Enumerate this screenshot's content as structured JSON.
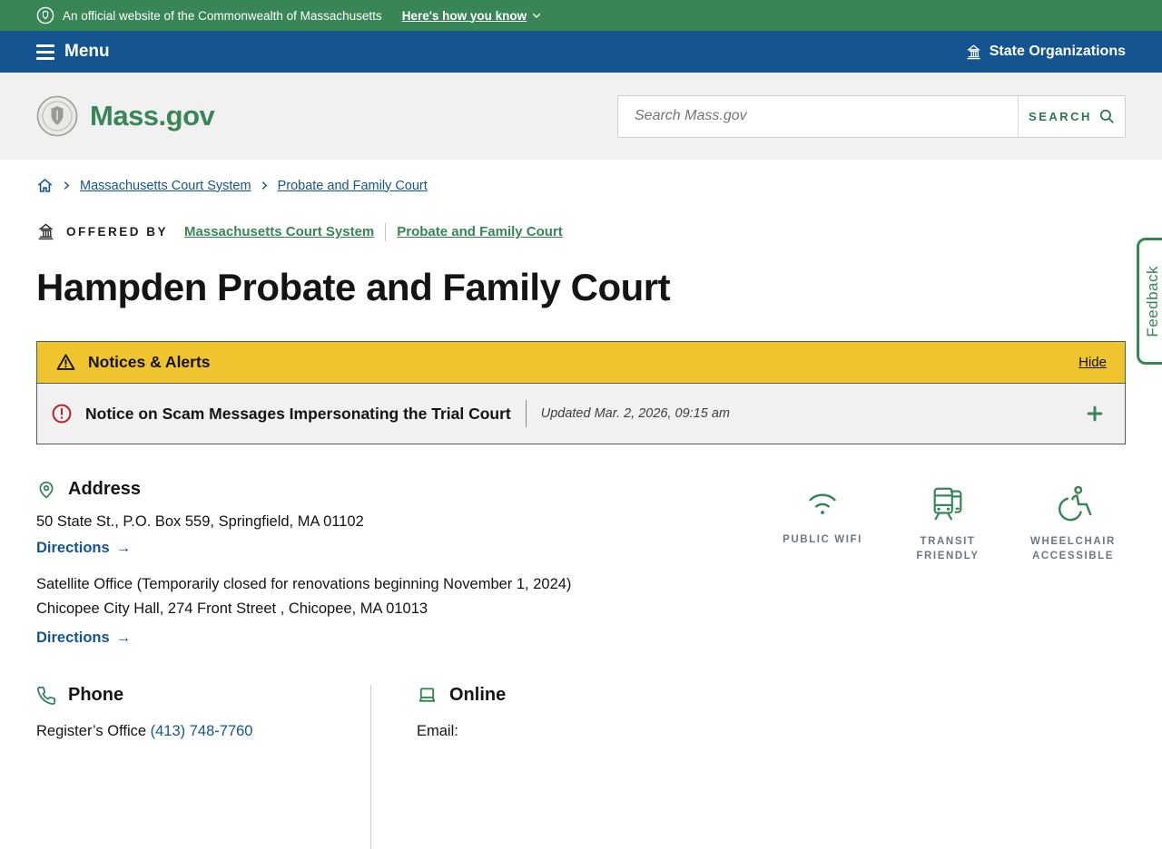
{
  "colors": {
    "green": "#388557",
    "blue": "#14558f",
    "yellow": "#f0c42e",
    "red": "#b7232e",
    "muted_label": "#6f7780",
    "text": "#141414"
  },
  "banner": {
    "text": "An official website of the Commonwealth of Massachusetts",
    "link": "Here's how you know"
  },
  "nav": {
    "menu": "Menu",
    "state_organizations": "State Organizations"
  },
  "header": {
    "logo": "Mass.gov",
    "search_placeholder": "Search Mass.gov",
    "search_button": "SEARCH"
  },
  "breadcrumb": {
    "items": [
      {
        "label": "Massachusetts Court System"
      },
      {
        "label": "Probate and Family Court"
      }
    ]
  },
  "offered_by": {
    "label": "OFFERED BY",
    "links": [
      {
        "label": "Massachusetts Court System"
      },
      {
        "label": "Probate and Family Court"
      }
    ]
  },
  "page": {
    "title": "Hampden Probate and Family Court"
  },
  "notices": {
    "heading": "Notices & Alerts",
    "hide": "Hide",
    "items": [
      {
        "title": "Notice on Scam Messages Impersonating the Trial Court",
        "updated": "Updated Mar. 2, 2026, 09:15 am",
        "expand": "+"
      }
    ]
  },
  "address": {
    "heading": "Address",
    "main": "50 State St., P.O. Box 559, Springfield, MA 01102",
    "directions": "Directions",
    "arrow": "→",
    "satellite_line1": "Satellite Office (Temporarily closed for renovations beginning November 1, 2024)",
    "satellite_line2": "Chicopee City Hall, 274 Front Street , Chicopee, MA 01013",
    "satellite_directions": "Directions"
  },
  "amenities": [
    {
      "icon": "wifi-icon",
      "label": "PUBLIC WIFI"
    },
    {
      "icon": "transit-icon",
      "label": "TRANSIT FRIENDLY"
    },
    {
      "icon": "wheelchair-icon",
      "label": "WHEELCHAIR ACCESSIBLE"
    }
  ],
  "contact": {
    "phone": {
      "heading": "Phone",
      "line_label": "Register’s Office ",
      "number": "(413) 748-7760"
    },
    "online": {
      "heading": "Online",
      "email_label": "Email:"
    }
  },
  "feedback": {
    "label": "Feedback"
  }
}
